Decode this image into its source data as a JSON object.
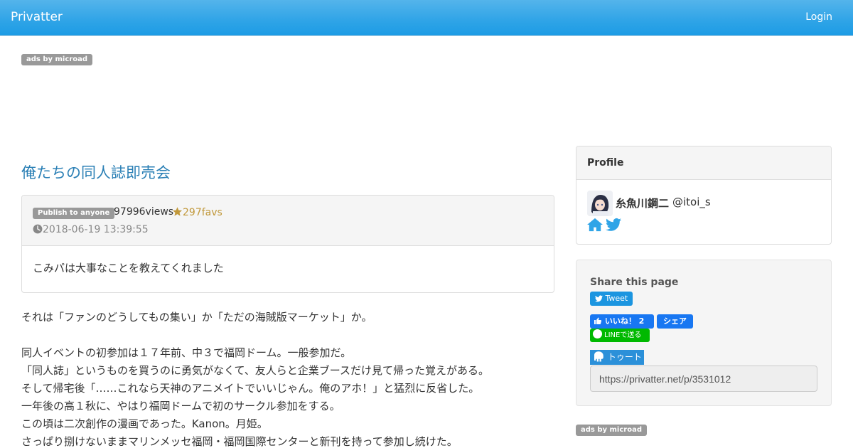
{
  "nav": {
    "brand": "Privatter",
    "login": "Login"
  },
  "ads": {
    "label": "ads by microad"
  },
  "post": {
    "title": "俺たちの同人誌即売会",
    "visibility": "Publish to anyone",
    "views": "97996views",
    "favs": "297favs",
    "date": "2018-06-19 13:39:55",
    "summary": "こみパは大事なことを教えてくれました",
    "lines": [
      "それは「ファンのどうしてもの集い」か「ただの海賊版マーケット」か。",
      "",
      "同人イベントの初参加は１７年前、中３で福岡ドーム。一般参加だ。",
      "「同人誌」というものを買うのに勇気がなくて、友人らと企業ブースだけ見て帰った覚えがある。",
      "そして帰宅後「……これなら天神のアニメイトでいいじゃん。俺のアホ！」と猛烈に反省した。",
      "一年後の高１秋に、やはり福岡ドームで初のサークル参加をする。",
      "この頃は二次創作の漫画であった。Kanon。月姫。",
      "さっぱり捌けないままマリンメッセ福岡・福岡国際センターと新刊を持って参加し続けた。"
    ]
  },
  "profile": {
    "heading": "Profile",
    "name": "糸魚川鋼二",
    "handle": "@itoi_s"
  },
  "share": {
    "heading": "Share this page",
    "tweet": "Tweet",
    "fb_like": "いいね！ 2",
    "fb_share": "シェア",
    "line": "LINEで送る",
    "toot": "トゥート",
    "url": "https://privatter.net/p/3531012"
  },
  "colors": {
    "navbar": "#2fa4e7",
    "title_link": "#2a7fb5",
    "fav_star": "#c1983a",
    "badge": "#999999",
    "twitter": "#1b95e0",
    "facebook": "#1877f2",
    "line": "#00b900",
    "mastodon": "#2b90d9"
  }
}
